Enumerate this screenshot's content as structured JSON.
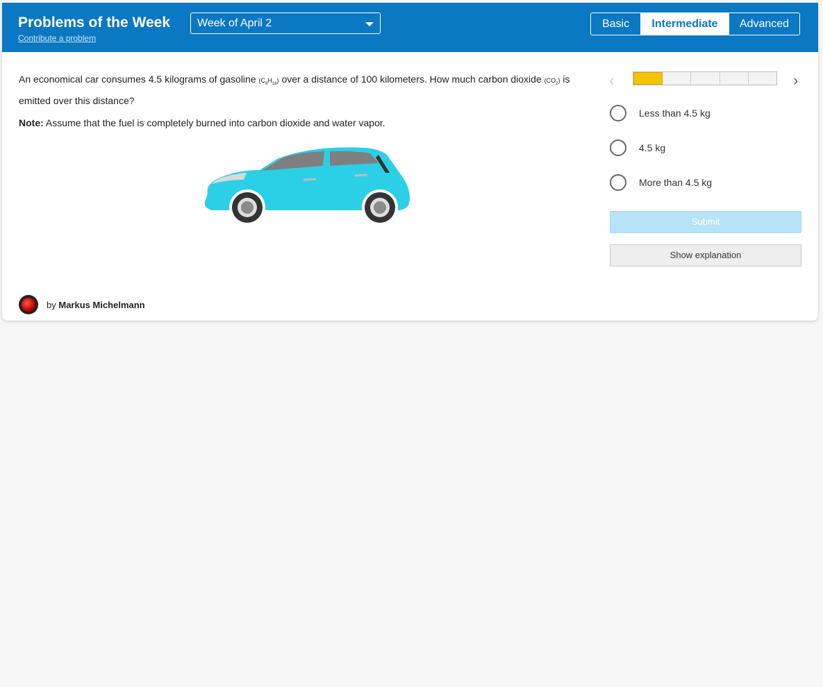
{
  "header": {
    "title": "Problems of the Week",
    "contribute_link": "Contribute a problem",
    "week_select": "Week of April 2",
    "levels": [
      "Basic",
      "Intermediate",
      "Advanced"
    ],
    "selected_level": "Intermediate"
  },
  "problem": {
    "text_part1": "An economical car consumes 4.5 kilograms of gasoline",
    "formula1_a": "(C",
    "formula1_sub1": "8",
    "formula1_b": "H",
    "formula1_sub2": "18",
    "formula1_c": ")",
    "text_part2": "over a distance of 100 kilometers. How much carbon dioxide",
    "formula2_a": "(CO",
    "formula2_sub": "2",
    "formula2_c": ")",
    "text_part3": "is emitted over this distance?",
    "note_label": "Note:",
    "note_text": "Assume that the fuel is completely burned into carbon dioxide and water vapor."
  },
  "progress": {
    "segments": 5,
    "filled": 1
  },
  "options": [
    "Less than 4.5 kg",
    "4.5 kg",
    "More than 4.5 kg"
  ],
  "buttons": {
    "submit": "Submit",
    "explanation": "Show explanation"
  },
  "author": {
    "by": "by",
    "name": "Markus Michelmann"
  },
  "colors": {
    "header_bg": "#0a78c2",
    "progress_fill": "#f5c400",
    "car_body": "#2bd0e6",
    "submit_bg": "#b7e2f7"
  }
}
